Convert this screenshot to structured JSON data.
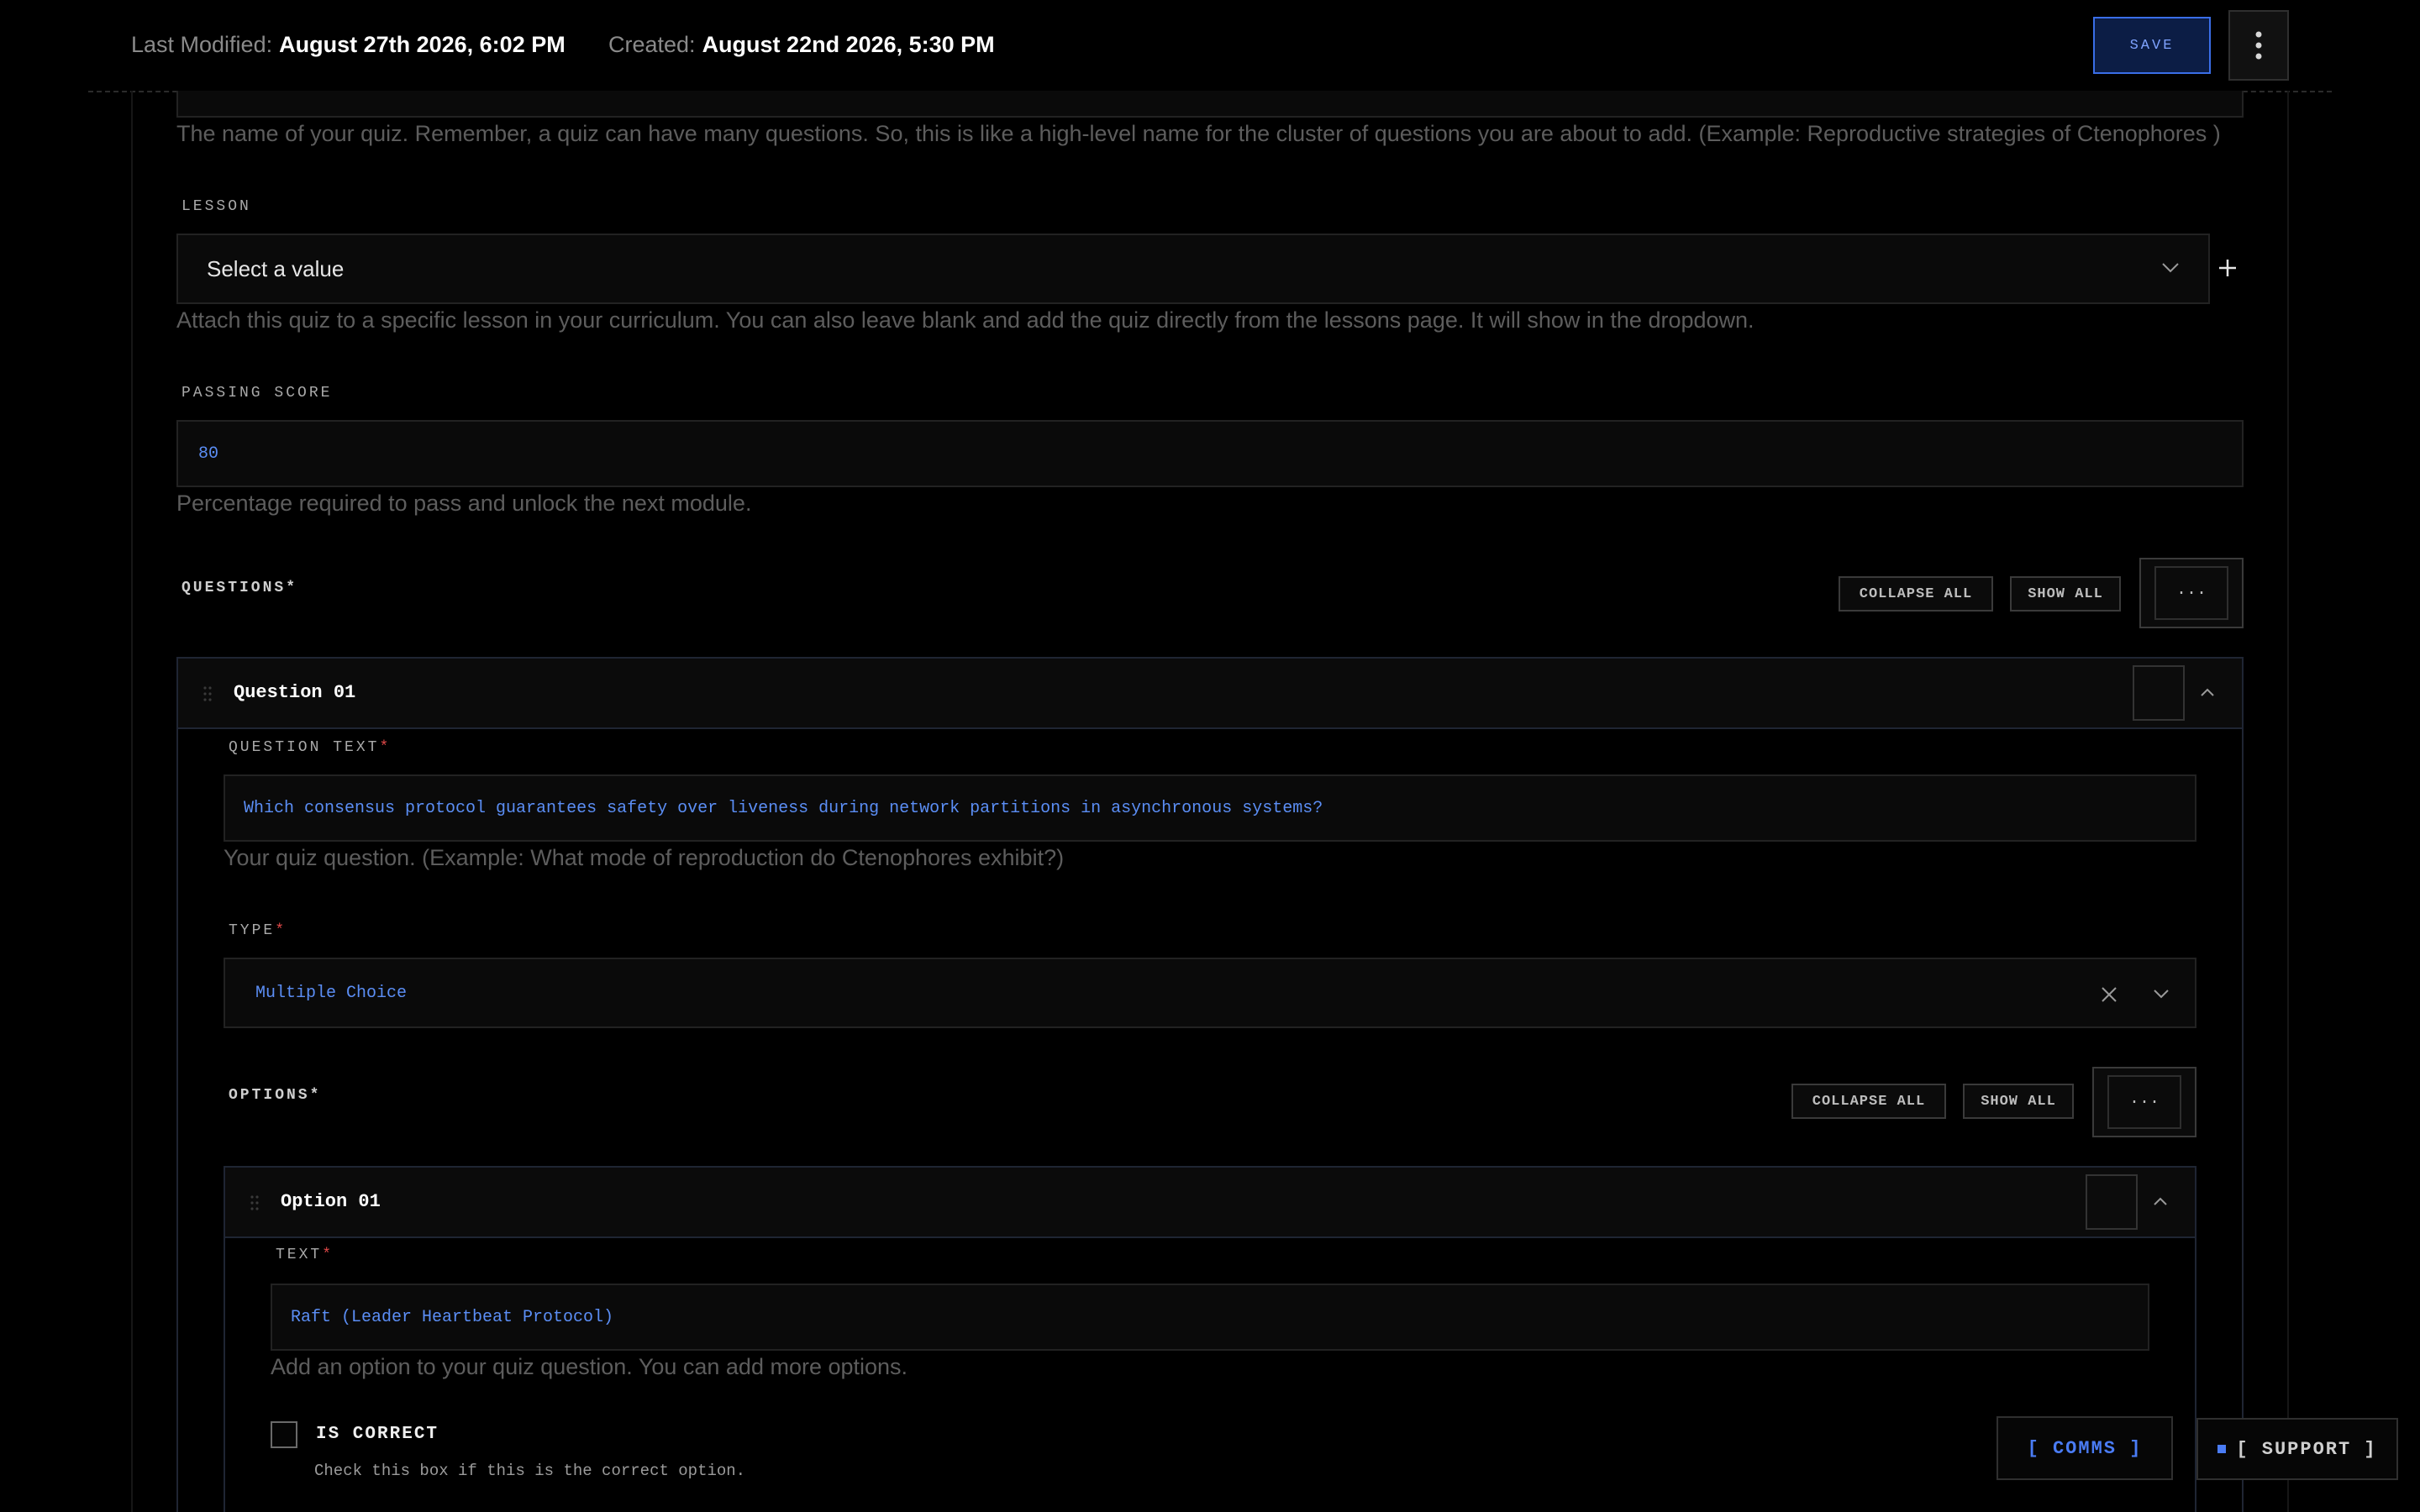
{
  "header": {
    "last_modified_label": "Last Modified:",
    "last_modified_value": "August 27th 2026, 6:02 PM",
    "created_label": "Created:",
    "created_value": "August 22nd 2026, 5:30 PM",
    "save_label": "SAVE",
    "more_icon": "kebab-vertical-icon"
  },
  "quiz_name": {
    "help": "The name of your quiz. Remember, a quiz can have many questions. So, this is like a high-level name for the cluster of questions you are about to add. (Example: Reproductive strategies of Ctenophores )"
  },
  "lesson": {
    "label": "LESSON",
    "placeholder": "Select a value",
    "help": "Attach this quiz to a specific lesson in your curriculum. You can also leave blank and add the quiz directly from the lessons page. It will show in the dropdown."
  },
  "passing_score": {
    "label": "PASSING SCORE",
    "value": "80",
    "help": "Percentage required to pass and unlock the next module."
  },
  "questions": {
    "label": "QUESTIONS",
    "required_mark": "*",
    "collapse_all": "COLLAPSE ALL",
    "show_all": "SHOW ALL",
    "more": "···",
    "items": [
      {
        "title": "Question 01",
        "question_text_label": "QUESTION TEXT",
        "question_text_value": "Which consensus protocol guarantees safety over liveness during network partitions in asynchronous systems?",
        "question_text_help": "Your quiz question. (Example: What mode of reproduction do Ctenophores exhibit?)",
        "type_label": "TYPE",
        "type_value": "Multiple Choice",
        "options": {
          "label": "OPTIONS",
          "collapse_all": "COLLAPSE ALL",
          "show_all": "SHOW ALL",
          "more": "···",
          "items": [
            {
              "title": "Option 01",
              "text_label": "TEXT",
              "text_value": "Raft (Leader Heartbeat Protocol)",
              "text_help": "Add an option to your quiz question. You can add more options.",
              "is_correct_label": "IS CORRECT",
              "is_correct_help": "Check this box if this is the correct option.",
              "is_correct": false
            }
          ]
        }
      }
    ]
  },
  "floating": {
    "comms": "[ COMMS ]",
    "support": "[ SUPPORT ]"
  },
  "colors": {
    "accent": "#4a7cf5",
    "required": "#e04848",
    "background": "#000000"
  }
}
